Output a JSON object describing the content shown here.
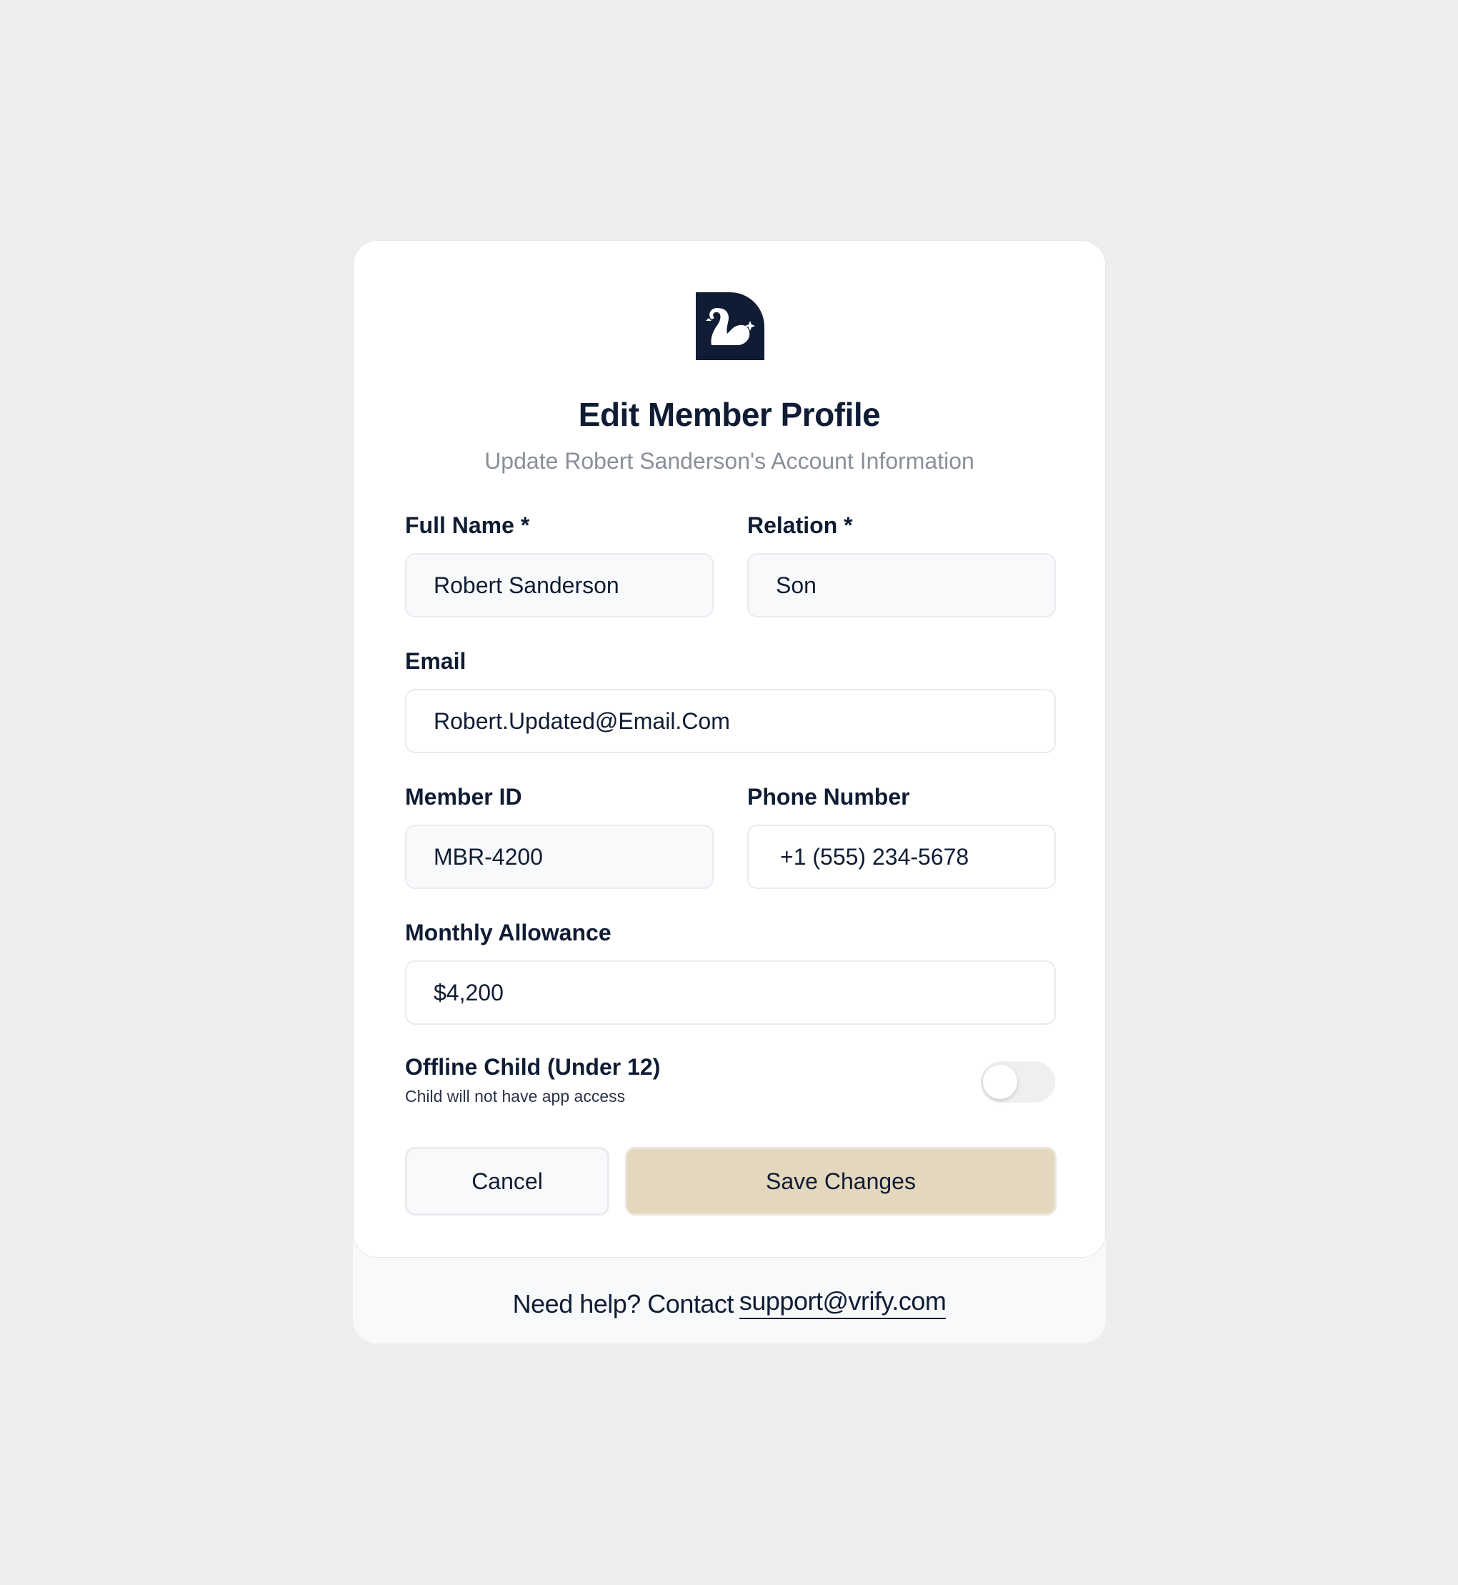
{
  "header": {
    "logo_icon": "swan-logo-icon",
    "title": "Edit Member Profile",
    "subtitle": "Update Robert Sanderson's Account Information"
  },
  "form": {
    "full_name": {
      "label": "Full Name *",
      "value": "Robert Sanderson"
    },
    "relation": {
      "label": "Relation *",
      "value": "Son"
    },
    "email": {
      "label": "Email",
      "value": "Robert.Updated@Email.Com"
    },
    "member_id": {
      "label": "Member ID",
      "value": "MBR-4200"
    },
    "phone": {
      "label": "Phone Number",
      "value": "+1 (555) 234-5678"
    },
    "allowance": {
      "label": "Monthly Allowance",
      "value": "$4,200"
    },
    "offline_child": {
      "label": "Offline Child (Under 12)",
      "hint": "Child will not have app access",
      "enabled": false
    }
  },
  "actions": {
    "cancel_label": "Cancel",
    "save_label": "Save Changes"
  },
  "footer": {
    "help_text": "Need help? Contact",
    "support_email": "support@vrify.com"
  },
  "colors": {
    "background": "#eeeeee",
    "text_primary": "#0f1c33",
    "text_muted": "#8a8f99",
    "save_button": "#e3d7bd",
    "logo": "#0f1c33"
  }
}
